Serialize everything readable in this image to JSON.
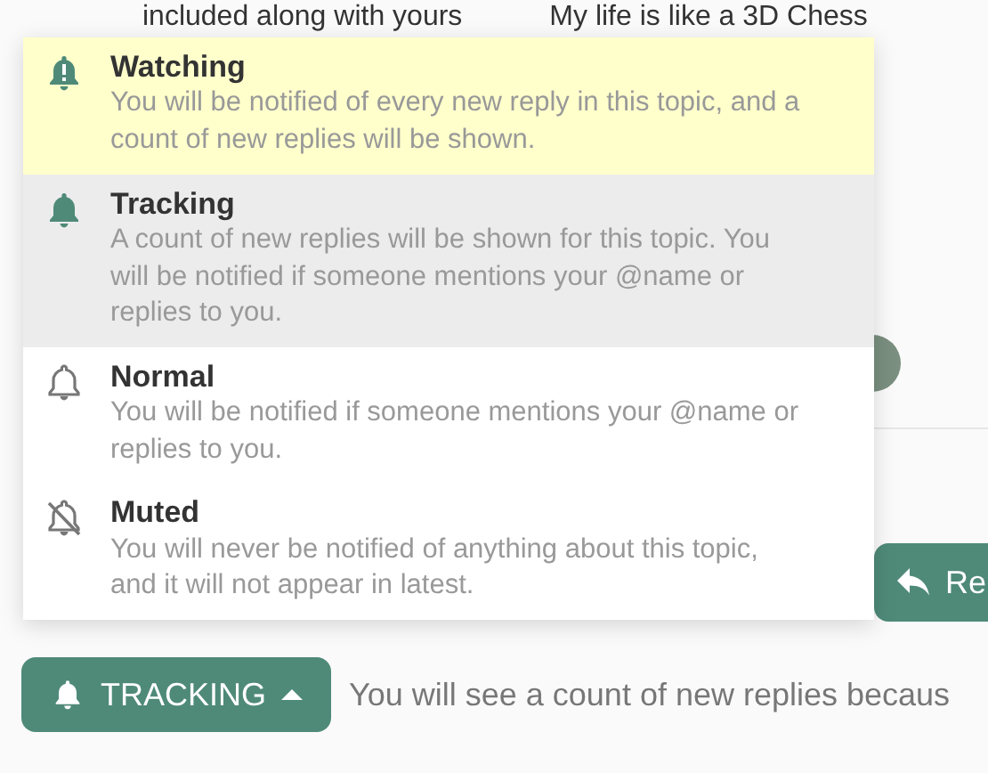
{
  "background_text": [
    "included along with yours",
    "My life is like a 3D Chess"
  ],
  "notification_menu": {
    "options": [
      {
        "kind": "watching",
        "title": "Watching",
        "description": "You will be notified of every new reply in this topic, and a count of new replies will be shown.",
        "hovered": true,
        "selected": false
      },
      {
        "kind": "tracking",
        "title": "Tracking",
        "description": "A count of new replies will be shown for this topic. You will be notified if someone mentions your @name or replies to you.",
        "hovered": false,
        "selected": true
      },
      {
        "kind": "normal",
        "title": "Normal",
        "description": "You will be notified if someone mentions your @name or replies to you.",
        "hovered": false,
        "selected": false
      },
      {
        "kind": "muted",
        "title": "Muted",
        "description": "You will never be notified of anything about this topic, and it will not appear in latest.",
        "hovered": false,
        "selected": false
      }
    ]
  },
  "reply_button": {
    "label": "Re"
  },
  "notification_button": {
    "label": "TRACKING",
    "expanded": true
  },
  "notification_reason": "You will see a count of new replies becaus"
}
